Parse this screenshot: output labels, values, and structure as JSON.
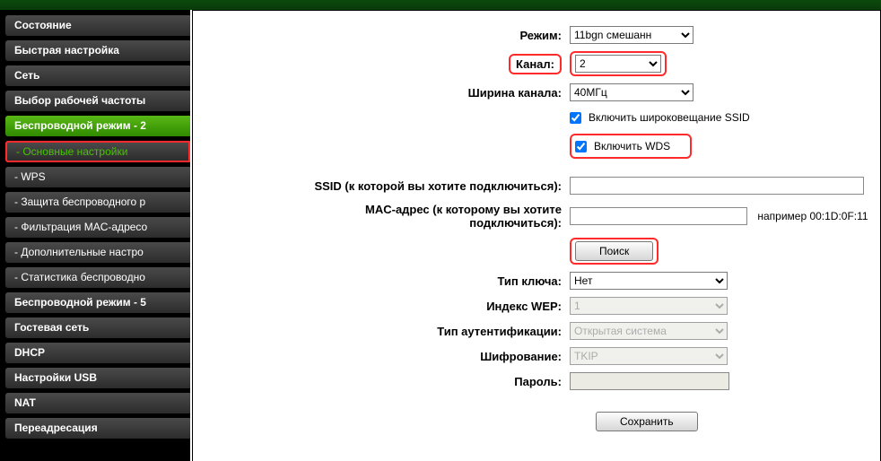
{
  "sidebar": {
    "items": [
      {
        "label": "Состояние"
      },
      {
        "label": "Быстрая настройка"
      },
      {
        "label": "Сеть"
      },
      {
        "label": "Выбор рабочей частоты"
      },
      {
        "label": "Беспроводной режим - 2"
      },
      {
        "label": "- Основные настройки"
      },
      {
        "label": "- WPS"
      },
      {
        "label": "- Защита беспроводного р"
      },
      {
        "label": "- Фильтрация MAC-адресо"
      },
      {
        "label": "- Дополнительные настро"
      },
      {
        "label": "- Статистика беспроводно"
      },
      {
        "label": "Беспроводной режим - 5"
      },
      {
        "label": "Гостевая сеть"
      },
      {
        "label": "DHCP"
      },
      {
        "label": "Настройки USB"
      },
      {
        "label": "NAT"
      },
      {
        "label": "Переадресация"
      }
    ]
  },
  "labels": {
    "mode": "Режим:",
    "channel": "Канал:",
    "channel_width": "Ширина канала:",
    "enable_ssid_broadcast": "Включить широковещание SSID",
    "enable_wds": "Включить WDS",
    "ssid": "SSID (к которой вы хотите подключиться):",
    "mac_l1": "MAC-адрес (к которому вы хотите",
    "mac_l2": "подключиться):",
    "mac_hint": "например 00:1D:0F:11",
    "search": "Поиск",
    "key_type": "Тип ключа:",
    "wep_index": "Индекс WEP:",
    "auth_type": "Тип аутентификации:",
    "encryption": "Шифрование:",
    "password": "Пароль:",
    "save": "Сохранить"
  },
  "values": {
    "mode": "11bgn смешанн",
    "channel": "2",
    "channel_width": "40МГц",
    "enable_ssid_broadcast": true,
    "enable_wds": true,
    "ssid": "",
    "mac": "",
    "key_type": "Нет",
    "wep_index": "1",
    "auth_type": "Открытая система",
    "encryption": "TKIP",
    "password": ""
  }
}
